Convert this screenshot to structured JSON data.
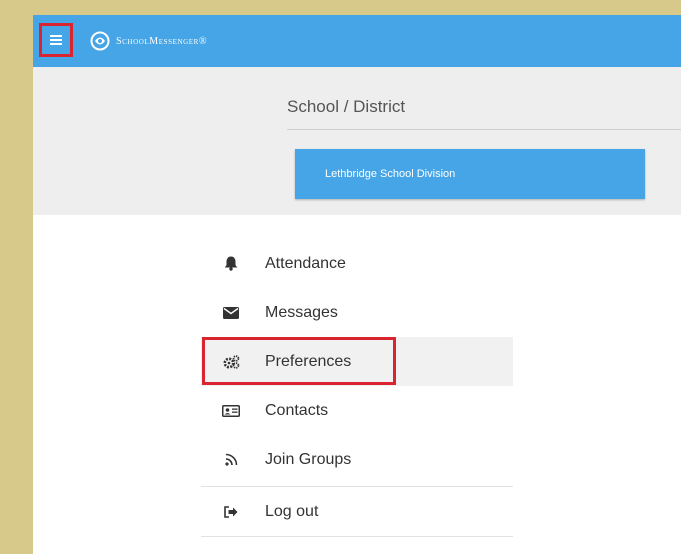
{
  "header": {
    "brand_name": "SchoolMessenger®",
    "brand_color": "#45a5e6",
    "menu_icon": "hamburger-icon",
    "logo_icon": "schoolmessenger-logo-icon"
  },
  "school": {
    "label": "School / District",
    "selected": "Lethbridge School Division"
  },
  "nav": {
    "items": [
      {
        "label": "Attendance",
        "icon": "bell-icon"
      },
      {
        "label": "Messages",
        "icon": "envelope-icon"
      },
      {
        "label": "Preferences",
        "icon": "gears-icon"
      },
      {
        "label": "Contacts",
        "icon": "id-card-icon"
      },
      {
        "label": "Join Groups",
        "icon": "rss-icon"
      },
      {
        "label": "Log out",
        "icon": "sign-out-icon"
      }
    ]
  },
  "highlight_color": "#d8252f"
}
